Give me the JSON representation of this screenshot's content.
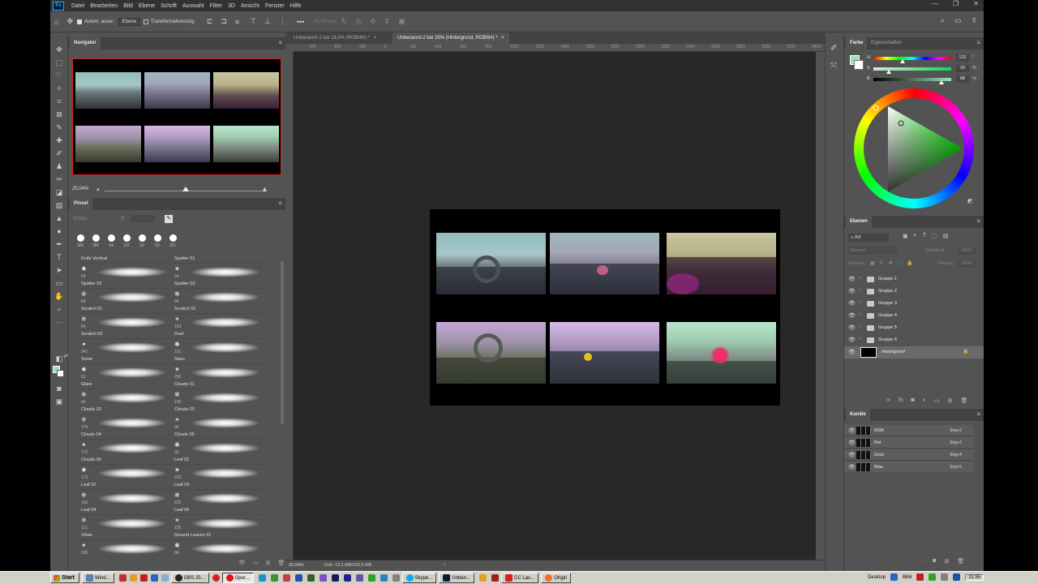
{
  "menubar": {
    "items": [
      "Datei",
      "Bearbeiten",
      "Bild",
      "Ebene",
      "Schrift",
      "Auswahl",
      "Filter",
      "3D",
      "Ansicht",
      "Fenster",
      "Hilfe"
    ]
  },
  "options": {
    "auto_select_label": "Autom. ausw.:",
    "auto_select_value": "Ebene",
    "transform_label": "Transformationsstrg.",
    "mode3d_label": "3D-Modus:"
  },
  "navigator": {
    "tab_label": "Navigator",
    "zoom": "25,04%",
    "zoom_fraction": 0.5
  },
  "brushes": {
    "tab_label": "Pinsel",
    "size_label": "Größe:",
    "presets": [
      "366",
      "280",
      "94",
      "107",
      "32",
      "50",
      "251"
    ],
    "items": [
      {
        "name": "Knife Vertical",
        "size": ""
      },
      {
        "name": "Spatter 01",
        "size": ""
      },
      {
        "name": "Spatter 02",
        "size": "64"
      },
      {
        "name": "Spatter 03",
        "size": "64"
      },
      {
        "name": "Scratch 01",
        "size": "64"
      },
      {
        "name": "Scratch 02",
        "size": "64"
      },
      {
        "name": "Scratch 03",
        "size": "64"
      },
      {
        "name": "Dust",
        "size": "153"
      },
      {
        "name": "Snow",
        "size": "341"
      },
      {
        "name": "Stars",
        "size": "101"
      },
      {
        "name": "Glare",
        "size": "81"
      },
      {
        "name": "Clouds 01",
        "size": "200"
      },
      {
        "name": "Clouds 02",
        "size": "60"
      },
      {
        "name": "Clouds 03",
        "size": "100"
      },
      {
        "name": "Clouds 04",
        "size": "175"
      },
      {
        "name": "Clouds 05",
        "size": "90"
      },
      {
        "name": "Clouds 06",
        "size": "175"
      },
      {
        "name": "Leaf 01",
        "size": "90"
      },
      {
        "name": "Leaf 02",
        "size": "173"
      },
      {
        "name": "Leaf 03",
        "size": "223"
      },
      {
        "name": "Leaf 04",
        "size": "100"
      },
      {
        "name": "Leaf 05",
        "size": "815"
      },
      {
        "name": "Vines",
        "size": "121"
      },
      {
        "name": "Ground Leaves 01",
        "size": "105"
      },
      {
        "name": "",
        "size": "105"
      },
      {
        "name": "",
        "size": "88"
      }
    ]
  },
  "document": {
    "tabs": [
      {
        "label": "Unbenannt-1 bei 18,4% (RGB/8#) *",
        "active": false
      },
      {
        "label": "Unbenannt-2 bei 25% (Hintergrund, RGB/8#) *",
        "active": true
      }
    ],
    "ruler_ticks": [
      "600",
      "400",
      "200",
      "0",
      "200",
      "400",
      "600",
      "800",
      "1000",
      "1200",
      "1400",
      "1600",
      "1800",
      "2000",
      "2200",
      "2400",
      "2600",
      "2800",
      "3000",
      "3200",
      "3400"
    ],
    "status_zoom": "25,04%",
    "status_doc": "Dok: 13,2 MB/192,5 MB"
  },
  "color_panel": {
    "tabs": [
      "Farbe",
      "Eigenschaften"
    ],
    "sliders": [
      {
        "label": "H",
        "value": "132",
        "unit": "°",
        "fraction": 0.37
      },
      {
        "label": "S",
        "value": "20",
        "unit": "%",
        "fraction": 0.2
      },
      {
        "label": "B",
        "value": "88",
        "unit": "%",
        "fraction": 0.88
      }
    ],
    "foreground": "#9ee0b6",
    "background": "#ffffff"
  },
  "layers": {
    "tab_label": "Ebenen",
    "filter_label": "Art",
    "blend_mode": "Normal",
    "opacity_label": "Deckkraft:",
    "opacity_value": "100%",
    "lock_label": "Fixieren:",
    "fill_label": "Fläche:",
    "fill_value": "100%",
    "items": [
      {
        "name": "Gruppe 1",
        "type": "group"
      },
      {
        "name": "Gruppe 2",
        "type": "group"
      },
      {
        "name": "Gruppe 3",
        "type": "group"
      },
      {
        "name": "Gruppe 4",
        "type": "group"
      },
      {
        "name": "Gruppe 5",
        "type": "group"
      },
      {
        "name": "Gruppe 6",
        "type": "group"
      },
      {
        "name": "Hintergrund",
        "type": "background"
      }
    ]
  },
  "channels": {
    "tab_label": "Kanäle",
    "items": [
      {
        "name": "RGB",
        "key": "Strg+2"
      },
      {
        "name": "Rot",
        "key": "Strg+3"
      },
      {
        "name": "Grün",
        "key": "Strg+4"
      },
      {
        "name": "Blau",
        "key": "Strg+5"
      }
    ]
  },
  "taskbar": {
    "start_label": "Start",
    "tasks": [
      "Wind...",
      "OBS 25...",
      "Oper...",
      "Skype...",
      "Unben...",
      "CC Lau...",
      "Origin"
    ],
    "tray_desktop": "Desktop",
    "tray_library": "Bibli",
    "clock": "11:55"
  }
}
